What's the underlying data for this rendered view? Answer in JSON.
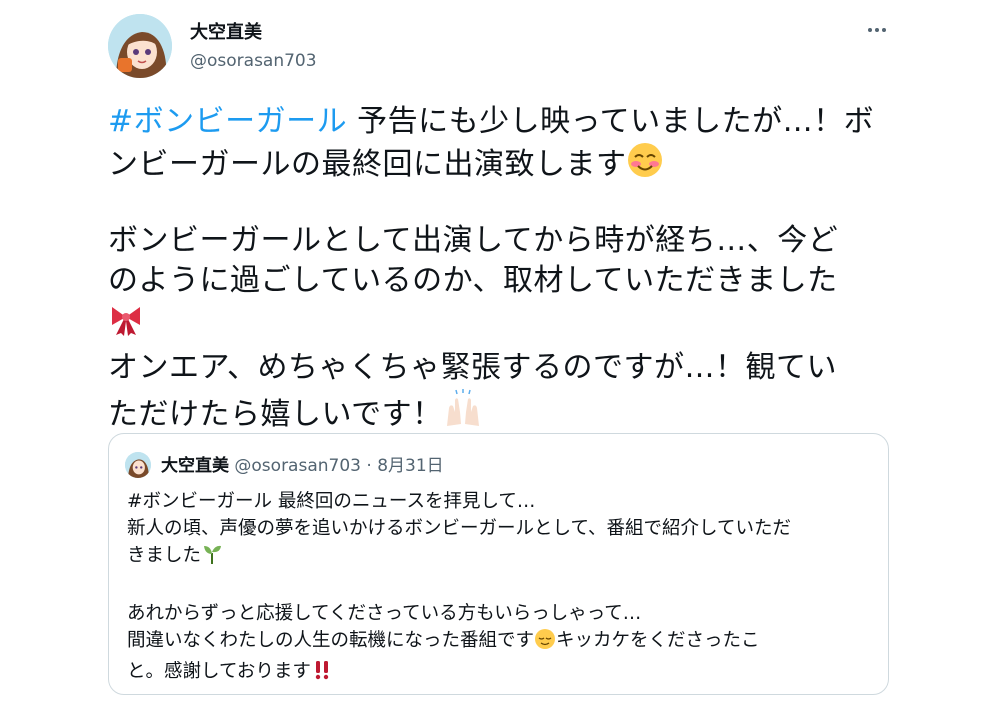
{
  "author": {
    "display_name": "大空直美",
    "handle": "@osorasan703"
  },
  "tweet": {
    "hashtag": "#ボンビーガール",
    "lines": [
      " 予告にも少し映っていましたが…！ボ",
      "ンビーガールの最終回に出演致します",
      "ボンビーガールとして出演してから時が経ち…、今ど",
      "のように過ごしているのか、取材していただきました",
      "オンエア、めちゃくちゃ緊張するのですが…！観てい",
      "ただけたら嬉しいです！"
    ],
    "emojis": [
      "smiling-blush-emoji",
      "ribbon-emoji",
      "raised-hands-emoji"
    ]
  },
  "quote": {
    "display_name": "大空直美",
    "handle": "@osorasan703",
    "separator": "·",
    "date": "8月31日",
    "lines": [
      "#ボンビーガール 最終回のニュースを拝見して…",
      "新人の頃、声優の夢を追いかけるボンビーガールとして、番組で紹介していただ",
      "きました",
      "あれからずっと応援してくださっている方もいらっしゃって…",
      "間違いなくわたしの人生の転機になった番組です",
      "キッカケをくださったこ",
      "と。感謝しております"
    ],
    "emojis": [
      "seedling-emoji",
      "relieved-face-emoji",
      "double-exclamation-emoji"
    ]
  },
  "colors": {
    "text": "#0f1419",
    "secondary": "#536471",
    "link": "#1d9bf0",
    "border": "#cfd9de"
  }
}
